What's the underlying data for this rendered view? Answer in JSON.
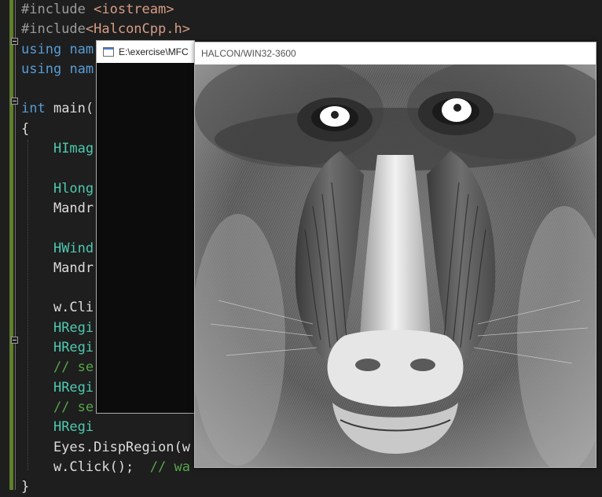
{
  "editor": {
    "lines": [
      {
        "parts": [
          {
            "c": "pp",
            "t": "#include "
          },
          {
            "c": "inc",
            "t": "<iostream>"
          }
        ]
      },
      {
        "parts": [
          {
            "c": "pp",
            "t": "#include"
          },
          {
            "c": "inc",
            "t": "<HalconCpp.h>"
          }
        ]
      },
      {
        "parts": [
          {
            "c": "kw",
            "t": "using"
          },
          {
            "c": "",
            "t": " "
          },
          {
            "c": "kw",
            "t": "nam"
          }
        ]
      },
      {
        "parts": [
          {
            "c": "kw",
            "t": "using"
          },
          {
            "c": "",
            "t": " "
          },
          {
            "c": "kw",
            "t": "nam"
          }
        ]
      },
      {
        "parts": []
      },
      {
        "parts": [
          {
            "c": "kw",
            "t": "int"
          },
          {
            "c": "",
            "t": " main("
          }
        ]
      },
      {
        "parts": [
          {
            "c": "",
            "t": "{"
          }
        ]
      },
      {
        "parts": [
          {
            "c": "",
            "t": "    "
          },
          {
            "c": "ty",
            "t": "HImag"
          }
        ]
      },
      {
        "parts": []
      },
      {
        "parts": [
          {
            "c": "",
            "t": "    "
          },
          {
            "c": "ty",
            "t": "Hlong"
          }
        ]
      },
      {
        "parts": [
          {
            "c": "",
            "t": "    Mandr"
          }
        ]
      },
      {
        "parts": []
      },
      {
        "parts": [
          {
            "c": "",
            "t": "    "
          },
          {
            "c": "ty",
            "t": "HWind"
          }
        ]
      },
      {
        "parts": [
          {
            "c": "",
            "t": "    Mandr"
          }
        ]
      },
      {
        "parts": []
      },
      {
        "parts": [
          {
            "c": "",
            "t": "    w.Cli"
          }
        ]
      },
      {
        "parts": [
          {
            "c": "",
            "t": "    "
          },
          {
            "c": "ty",
            "t": "HRegi"
          }
        ]
      },
      {
        "parts": [
          {
            "c": "",
            "t": "    "
          },
          {
            "c": "ty",
            "t": "HRegi"
          }
        ]
      },
      {
        "parts": [
          {
            "c": "",
            "t": "    "
          },
          {
            "c": "cm",
            "t": "// se"
          }
        ]
      },
      {
        "parts": [
          {
            "c": "",
            "t": "    "
          },
          {
            "c": "ty",
            "t": "HRegi"
          }
        ]
      },
      {
        "parts": [
          {
            "c": "",
            "t": "    "
          },
          {
            "c": "cm",
            "t": "// se"
          }
        ]
      },
      {
        "parts": [
          {
            "c": "",
            "t": "    "
          },
          {
            "c": "ty",
            "t": "HRegi"
          }
        ]
      },
      {
        "parts": [
          {
            "c": "",
            "t": "    Eyes.DispRegion(w"
          }
        ]
      },
      {
        "parts": [
          {
            "c": "",
            "t": "    w.Click();  "
          },
          {
            "c": "cm",
            "t": "// wa"
          }
        ]
      },
      {
        "parts": [
          {
            "c": "",
            "t": "}"
          }
        ]
      }
    ]
  },
  "console_window": {
    "title": "E:\\exercise\\MFC"
  },
  "halcon_window": {
    "title": "HALCON/WIN32-3600"
  },
  "colors": {
    "keyword": "#569cd6",
    "type": "#4ec9b0",
    "comment": "#57a64a",
    "include": "#d69d85",
    "preprocessor": "#9b9b9b",
    "background": "#1e1e1e"
  }
}
